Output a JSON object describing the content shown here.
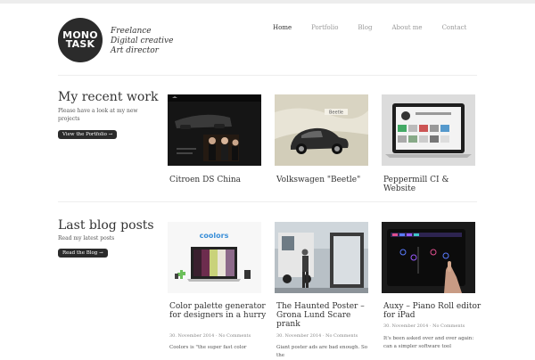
{
  "header": {
    "logo_line1": "MONO",
    "logo_line2": "TASK",
    "tagline": [
      "Freelance",
      "Digital creative",
      "Art director"
    ]
  },
  "nav": {
    "items": [
      {
        "label": "Home",
        "active": true
      },
      {
        "label": "Portfolio",
        "active": false
      },
      {
        "label": "Blog",
        "active": false
      },
      {
        "label": "About me",
        "active": false
      },
      {
        "label": "Contact",
        "active": false
      }
    ]
  },
  "portfolio": {
    "title": "My recent work",
    "desc": "Please have a look at my new projects",
    "button": "View the Portfolio →",
    "items": [
      {
        "caption": "Citroen DS China"
      },
      {
        "caption": "Volkswagen \"Beetle\""
      },
      {
        "caption": "Peppermill CI & Website"
      }
    ]
  },
  "blog": {
    "title": "Last blog posts",
    "desc": "Read my latest posts",
    "button": "Read the Blog →",
    "posts": [
      {
        "title": "Color palette generator for designers in a hurry",
        "meta": "30. November 2014 · No Comments",
        "excerpt": "Coolors is \"the super fast color"
      },
      {
        "title": "The Haunted Poster – Grona Lund Scare prank",
        "meta": "30. November 2014 · No Comments",
        "excerpt": "Giant poster ads are bad enough. So the"
      },
      {
        "title": "Auxy – Piano Roll editor for iPad",
        "meta": "30. November 2014 · No Comments",
        "excerpt": "It's been asked over and over again: can a simpler software tool"
      }
    ]
  },
  "images": {
    "coolors_text": "coolors",
    "vw_sign": "Beetle"
  }
}
